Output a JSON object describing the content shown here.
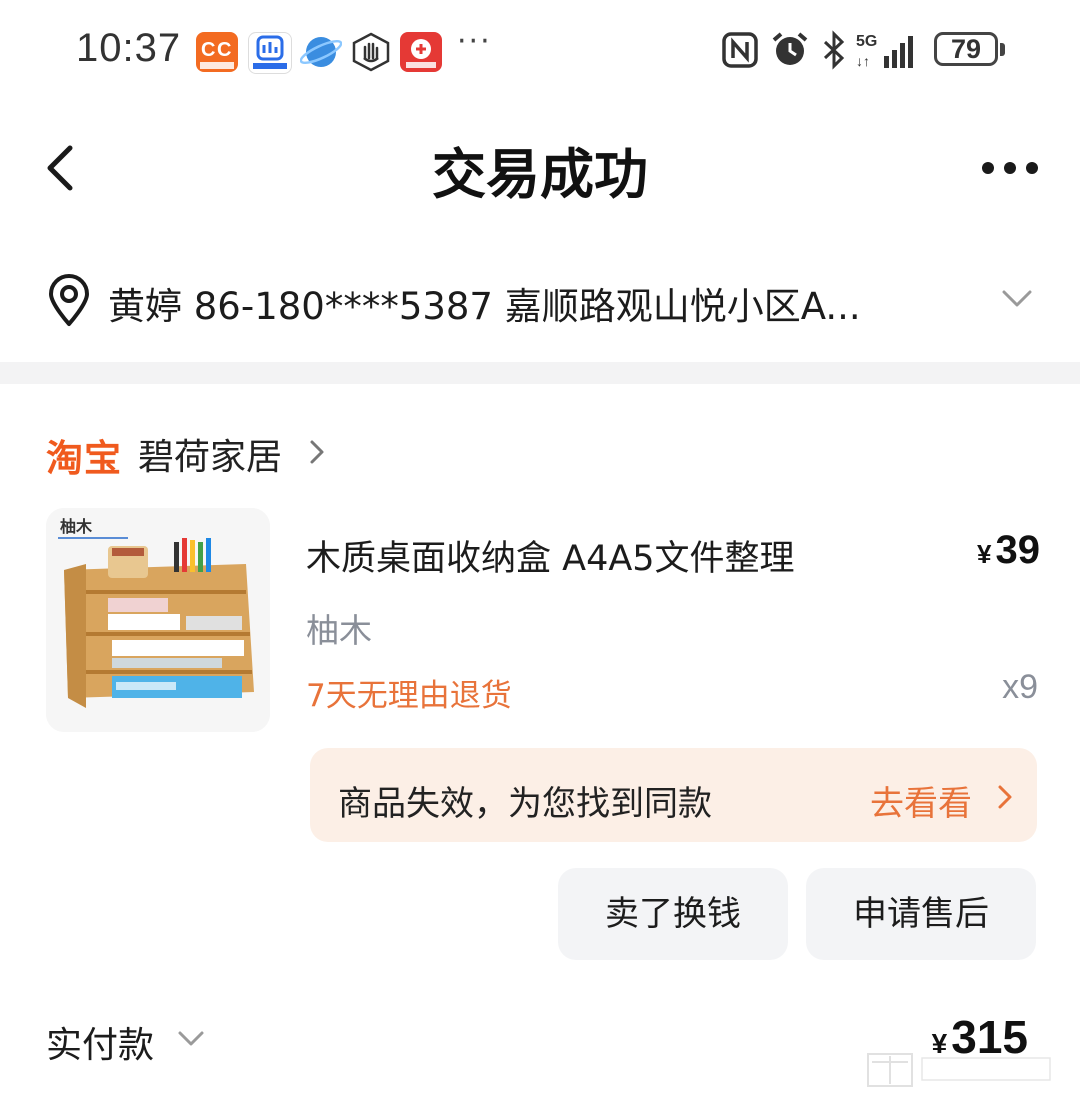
{
  "status_bar": {
    "time": "10:37",
    "battery": "79",
    "app_icons": [
      "1688-app-icon",
      "douyin-mall-icon",
      "browser-icon",
      "hand-icon",
      "pinduoduo-icon"
    ],
    "indicators": [
      "nfc-icon",
      "alarm-icon",
      "bluetooth-icon",
      "5g-signal-icon"
    ]
  },
  "header": {
    "title": "交易成功"
  },
  "address": {
    "text": "黄婷  86-180****5387  嘉顺路观山悦小区A..."
  },
  "shop": {
    "platform": "淘宝",
    "name": "碧荷家居"
  },
  "product": {
    "title": "木质桌面收纳盒 A4A5文件整理",
    "price_symbol": "¥",
    "price": "39",
    "spec": "柚木",
    "image_label": "柚木",
    "tag": "7天无理由退货",
    "quantity": "x9"
  },
  "notice": {
    "text": "商品失效，为您找到同款",
    "link": "去看看"
  },
  "actions": {
    "sell": "卖了换钱",
    "after_sale": "申请售后"
  },
  "payment": {
    "label": "实付款",
    "symbol": "¥",
    "amount": "315"
  },
  "colors": {
    "accent": "#e8733a",
    "taobao": "#f05a1e",
    "notice_bg": "#fcefe6",
    "button_bg": "#f3f4f6"
  }
}
